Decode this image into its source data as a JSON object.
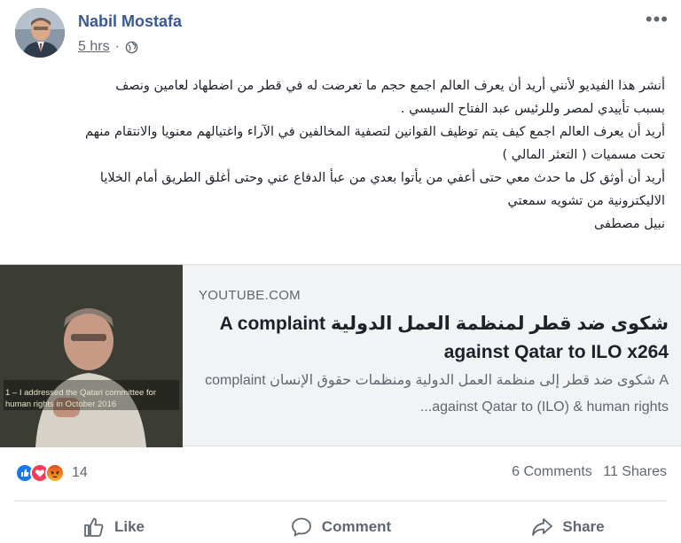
{
  "post": {
    "author": "Nabil Mostafa",
    "time": "5 hrs",
    "separator": "·",
    "privacy_icon": "globe-icon",
    "more_icon": "more-options-icon",
    "more_label": "•••",
    "text_lines": [
      "أنشر هذا الفيديو لأنني أريد أن يعرف العالم اجمع حجم ما تعرضت له في قطر من اضطهاد لعامين ونصف",
      "بسبب تأييدي لمصر وللرئيس عبد الفتاح السيسي .",
      "أريد أن يعرف العالم اجمع كيف يتم توظيف القوانين لتصفية المخالفين في الآراء واغتيالهم معنويا والانتقام منهم",
      "تحت مسميات ( التعثر المالي )",
      "أريد أن أوثق كل ما حدث معي حتى أعفي من يأتوا بعدي من عبأ الدفاع عني وحتى أغلق الطريق أمام الخلايا",
      "الاليكترونية من تشويه سمعتي",
      "نبيل مصطفى"
    ]
  },
  "link_card": {
    "source": "YOUTUBE.COM",
    "title": "شكوى ضد قطر لمنظمة العمل الدولية A complaint against Qatar to ILO x264",
    "description": "A شكوى ضد قطر إلى منظمة العمل الدولية ومنظمات حقوق الإنسان complaint against Qatar to (ILO) & human rights...",
    "thumbnail_caption": "1 – I addressed the Qatari committee for human rights in October 2016"
  },
  "engagement": {
    "reaction_icons": [
      "like-reaction-icon",
      "love-reaction-icon",
      "angry-reaction-icon"
    ],
    "reaction_count": "14",
    "comments": "6 Comments",
    "shares": "11 Shares"
  },
  "actions": {
    "like": "Like",
    "comment": "Comment",
    "share": "Share"
  },
  "colors": {
    "author_link": "#385898",
    "secondary_text": "#606770",
    "card_bg": "#f2f3f5",
    "like_blue": "#1877f2",
    "love_red": "#f33e58",
    "angry_orange": "#e9710f"
  }
}
